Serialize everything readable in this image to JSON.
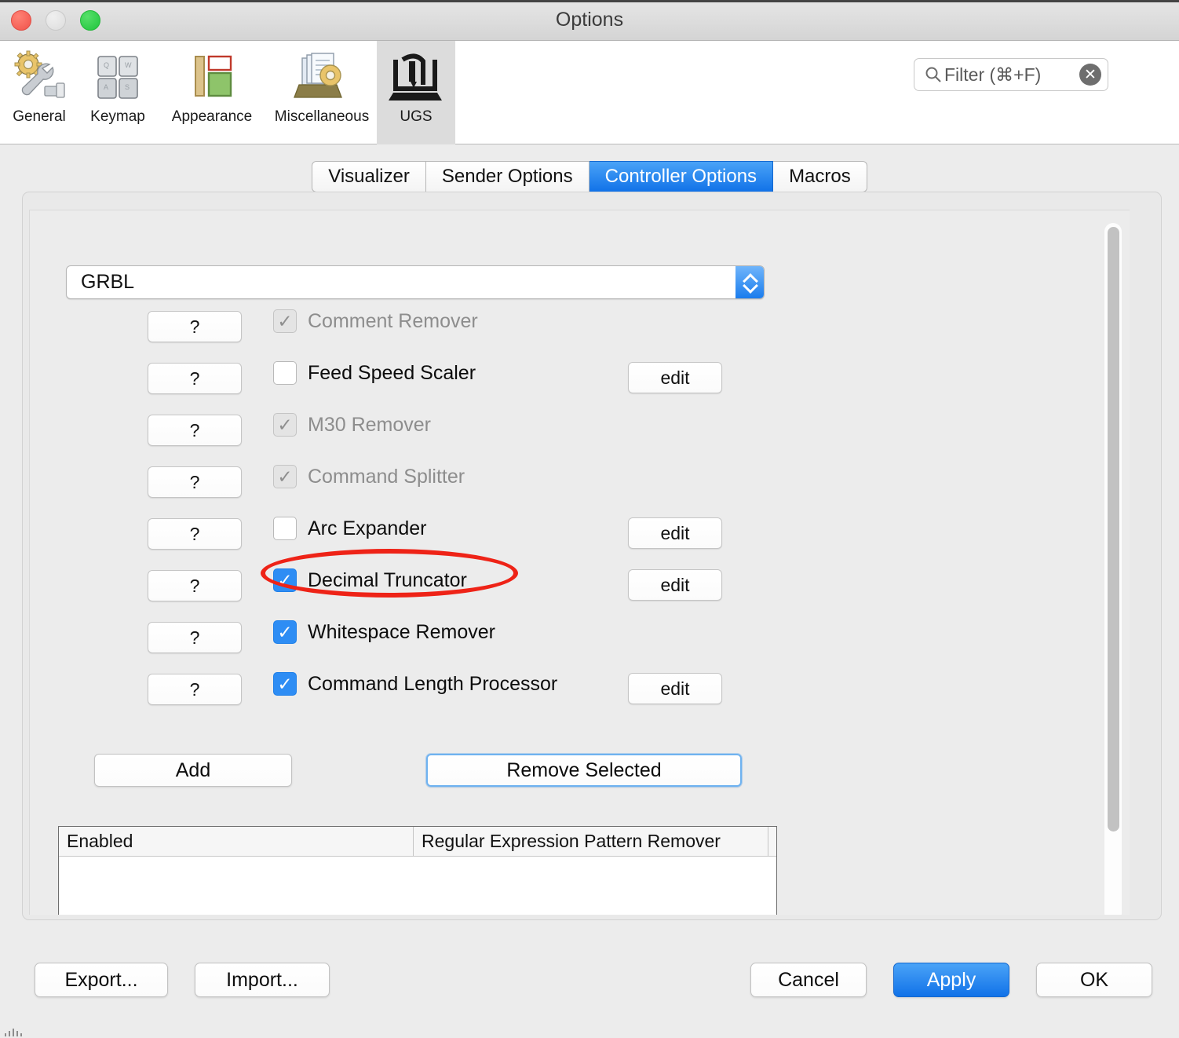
{
  "window": {
    "title": "Options",
    "traffic_lights": [
      "close",
      "minimize",
      "zoom"
    ]
  },
  "toolbar": {
    "items": [
      {
        "label": "General",
        "icon": "gear-wrench-icon",
        "selected": false
      },
      {
        "label": "Keymap",
        "icon": "keyboard-keys-icon",
        "selected": false
      },
      {
        "label": "Appearance",
        "icon": "color-panels-icon",
        "selected": false
      },
      {
        "label": "Miscellaneous",
        "icon": "documents-gear-icon",
        "selected": false
      },
      {
        "label": "UGS",
        "icon": "cnc-machine-icon",
        "selected": true
      }
    ],
    "filter": {
      "placeholder": "Filter (⌘+F)",
      "value": "",
      "search_icon": "search-icon",
      "clear_icon": "clear-circle-icon"
    }
  },
  "tabs": [
    {
      "label": "Visualizer",
      "active": false
    },
    {
      "label": "Sender Options",
      "active": false
    },
    {
      "label": "Controller Options",
      "active": true
    },
    {
      "label": "Macros",
      "active": false
    }
  ],
  "controller": {
    "firmware_select": {
      "value": "GRBL",
      "options": [
        "GRBL"
      ]
    },
    "help_label": "?",
    "edit_label": "edit",
    "processors": [
      {
        "name": "Comment Remover",
        "checked": true,
        "enabled": false,
        "has_edit": false
      },
      {
        "name": "Feed Speed Scaler",
        "checked": false,
        "enabled": true,
        "has_edit": true,
        "highlighted": true
      },
      {
        "name": "M30 Remover",
        "checked": true,
        "enabled": false,
        "has_edit": false
      },
      {
        "name": "Command Splitter",
        "checked": true,
        "enabled": false,
        "has_edit": false
      },
      {
        "name": "Arc Expander",
        "checked": false,
        "enabled": true,
        "has_edit": true
      },
      {
        "name": "Decimal Truncator",
        "checked": true,
        "enabled": true,
        "has_edit": true
      },
      {
        "name": "Whitespace Remover",
        "checked": true,
        "enabled": true,
        "has_edit": false
      },
      {
        "name": "Command Length Processor",
        "checked": true,
        "enabled": true,
        "has_edit": true
      }
    ],
    "add_label": "Add",
    "remove_label": "Remove Selected",
    "table": {
      "columns": [
        "Enabled",
        "Regular Expression Pattern Remover"
      ],
      "rows": []
    }
  },
  "footer": {
    "export_label": "Export...",
    "import_label": "Import...",
    "cancel_label": "Cancel",
    "apply_label": "Apply",
    "ok_label": "OK"
  },
  "annotation": {
    "type": "ellipse",
    "color": "#ee2317",
    "targets": "Feed Speed Scaler"
  },
  "colors": {
    "accent_blue": "#1172e8",
    "checkbox_blue": "#2e8df4",
    "annotation_red": "#ee2317",
    "window_bg": "#ececec"
  }
}
